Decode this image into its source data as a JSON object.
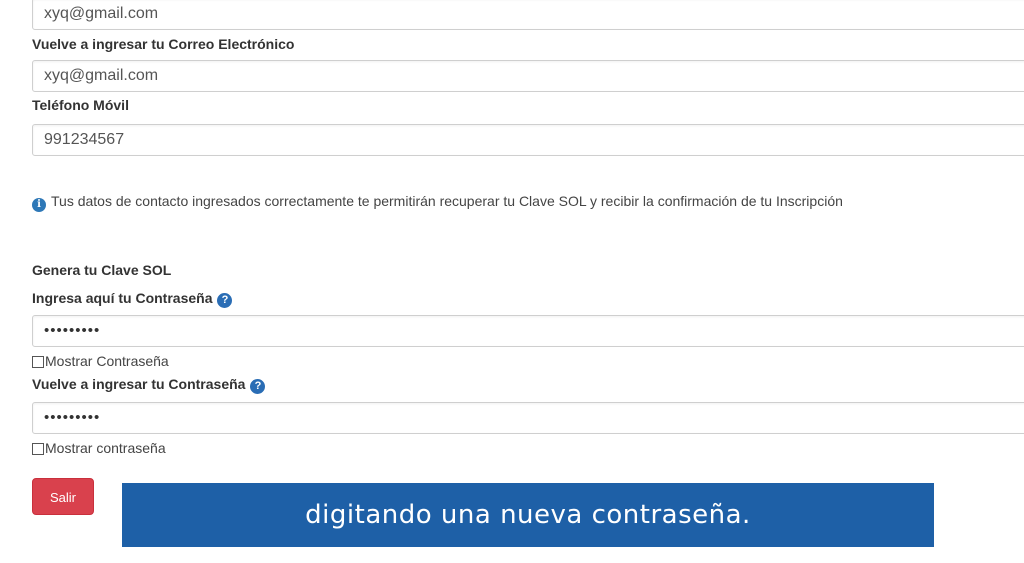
{
  "form": {
    "email_value": "xyq@gmail.com",
    "confirm_email_label": "Vuelve a ingresar tu Correo Electrónico",
    "confirm_email_value": "xyq@gmail.com",
    "phone_label": "Teléfono Móvil",
    "phone_value": "991234567",
    "info_text": "Tus datos de contacto ingresados correctamente te permitirán recuperar tu Clave SOL y recibir la confirmación de tu Inscripción",
    "section_title": "Genera tu Clave SOL",
    "password_label": "Ingresa aquí tu Contraseña",
    "password_value": "•••••••••",
    "show_password_label": "Mostrar Contraseña",
    "confirm_password_label": "Vuelve a ingresar tu Contraseña",
    "confirm_password_value": "•••••••••",
    "show_confirm_password_label": "Mostrar contraseña",
    "exit_button": "Salir"
  },
  "icons": {
    "help": "?",
    "info": "i"
  },
  "caption": {
    "text": "digitando una nueva contraseña."
  },
  "colors": {
    "exit_button": "#d9414d",
    "caption_background": "#1e60a7",
    "help_icon": "#2a6db5"
  }
}
